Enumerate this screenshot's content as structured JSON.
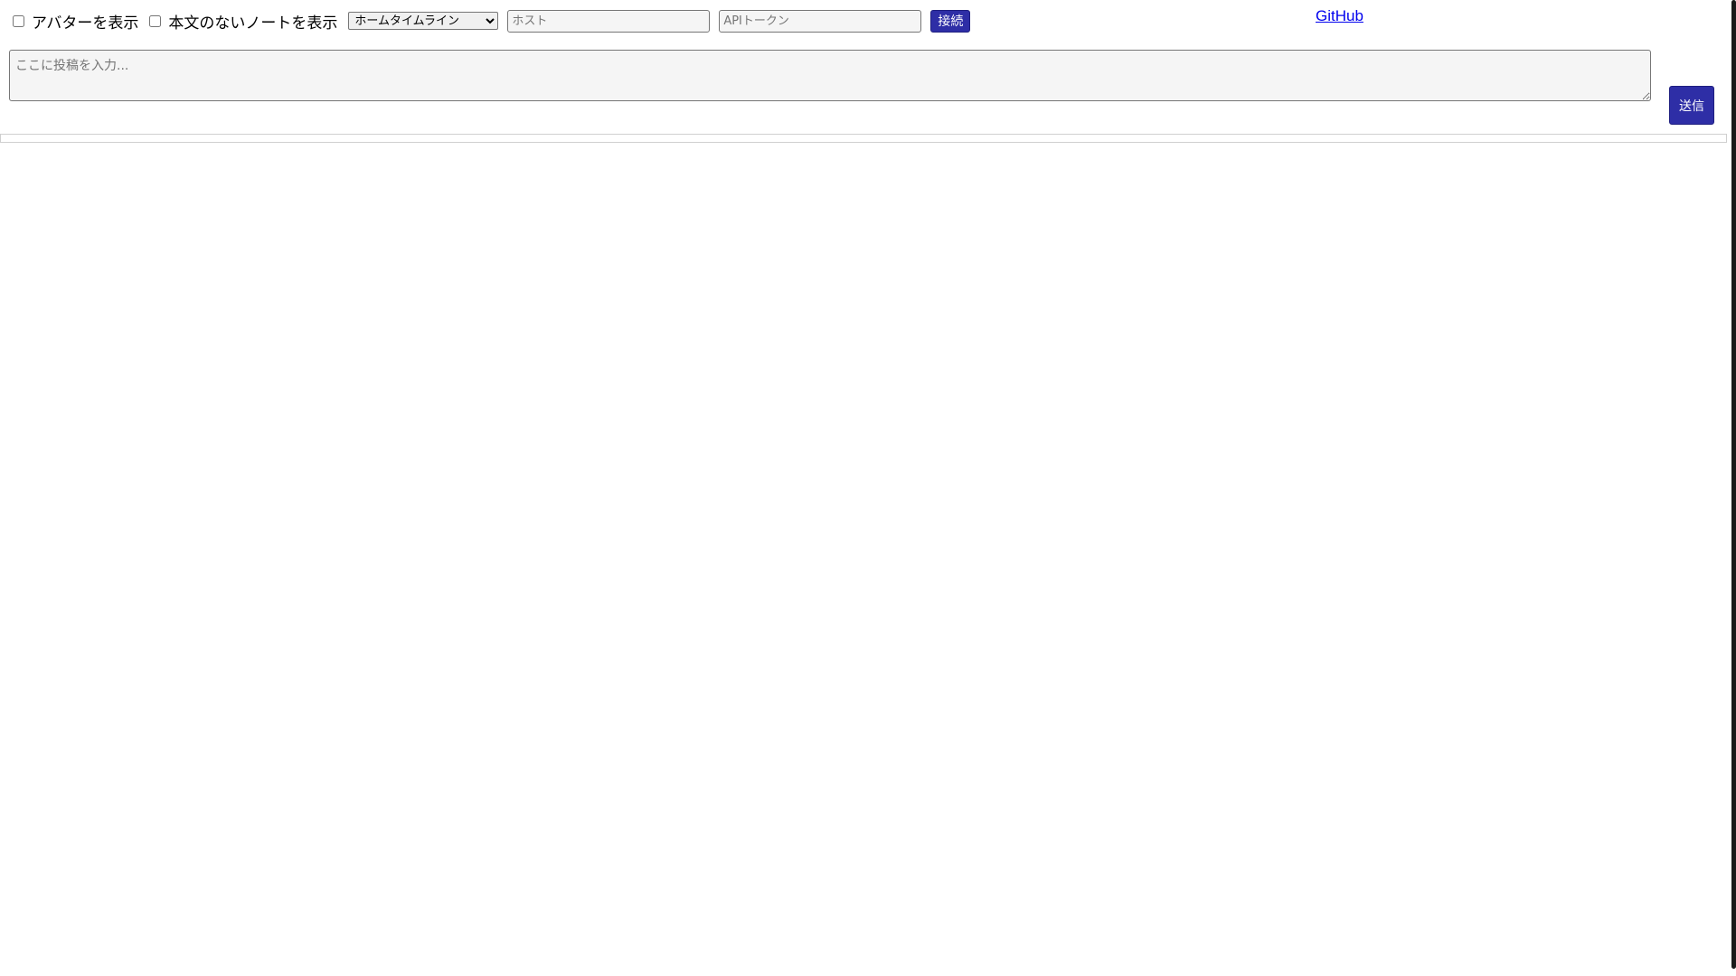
{
  "toolbar": {
    "show_avatar_label": "アバターを表示",
    "show_empty_notes_label": "本文のないノートを表示",
    "timeline_select": {
      "selected": "ホームタイムライン"
    },
    "host_input": {
      "value": "",
      "placeholder": "ホスト"
    },
    "token_input": {
      "value": "",
      "placeholder": "APIトークン"
    },
    "connect_label": "接続",
    "github_link": "GitHub"
  },
  "post": {
    "placeholder": "ここに投稿を入力...",
    "value": "",
    "send_label": "送信"
  },
  "colors": {
    "button_bg": "#2e2ea6",
    "link": "#0000ee",
    "input_bg": "#f5f5f5"
  }
}
